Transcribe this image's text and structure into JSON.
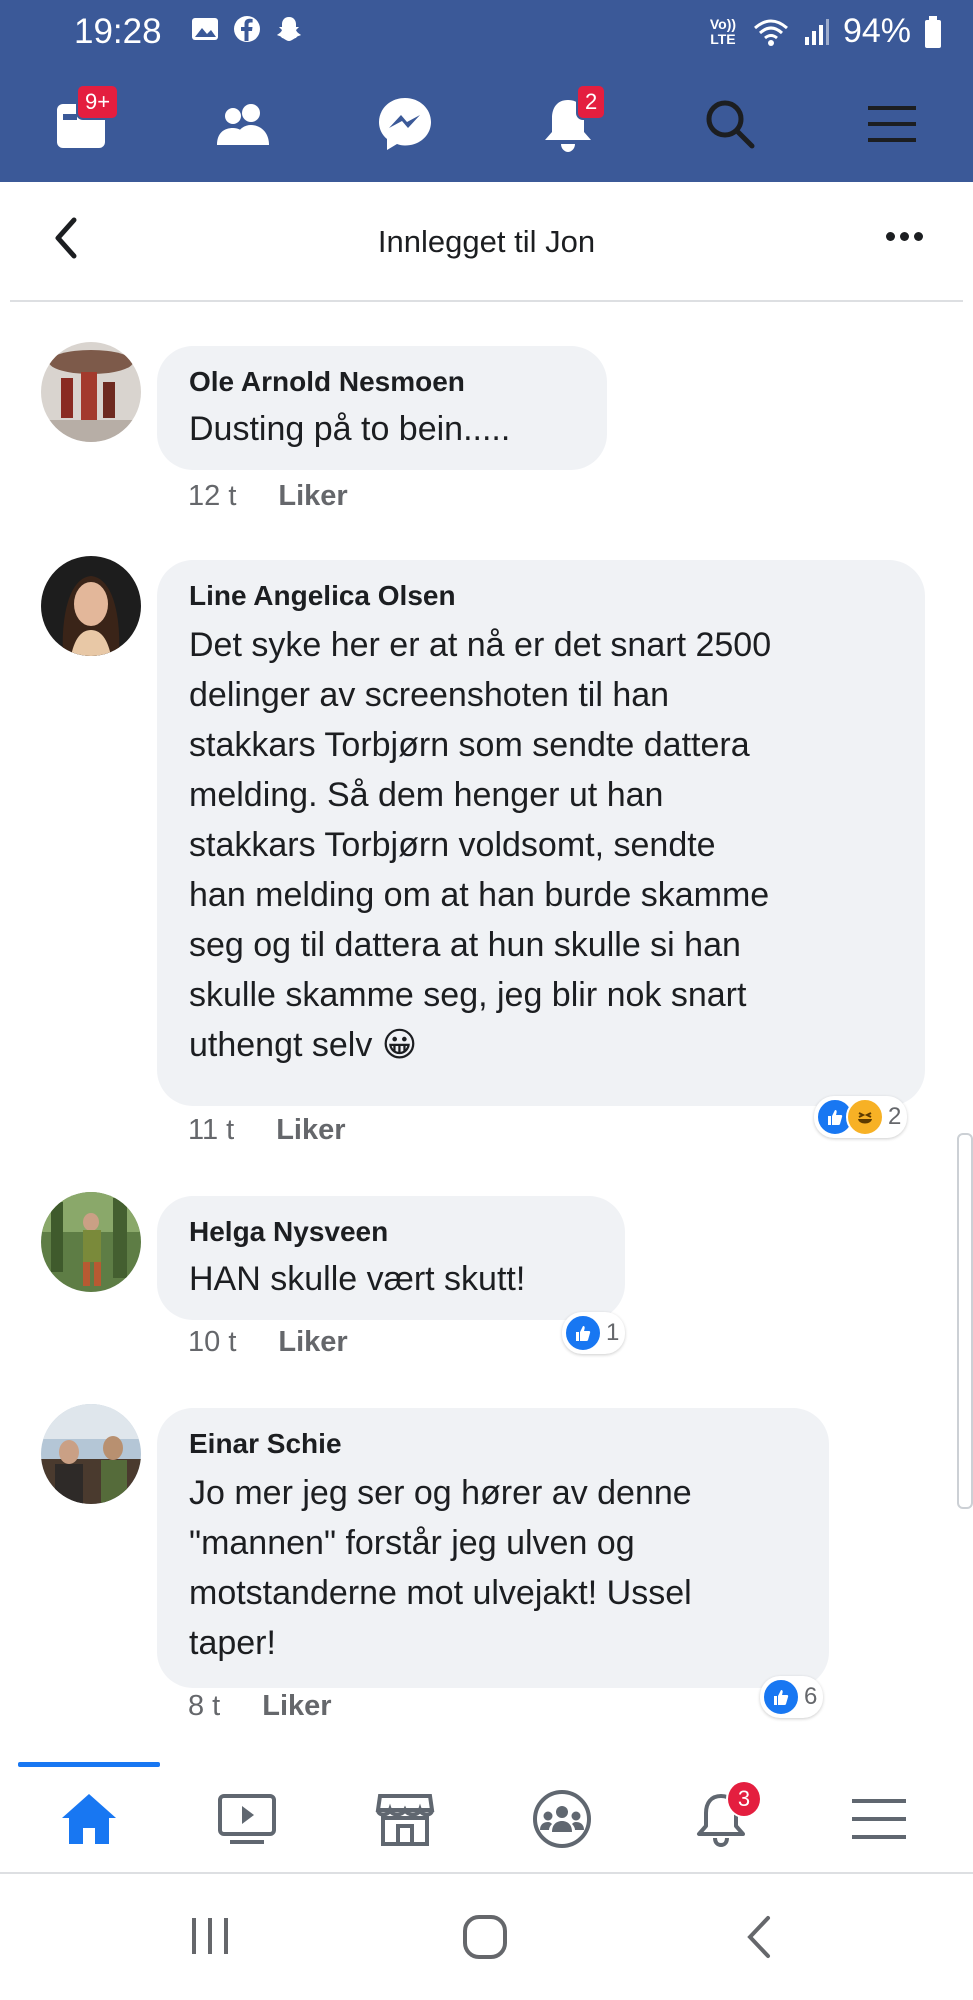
{
  "status_bar": {
    "time": "19:28",
    "network": "Vo)) LTE",
    "battery": "94%"
  },
  "top_nav": {
    "home_badge": "9+",
    "notifications_badge": "2"
  },
  "header": {
    "title": "Innlegget til Jon"
  },
  "comments": [
    {
      "name": "Ole Arnold Nesmoen",
      "text": "Dusting på to bein.....",
      "time": "12 t",
      "like_label": "Liker"
    },
    {
      "name": "Line Angelica Olsen",
      "text": "Det syke her er at nå er det snart 2500\ndelinger av screenshoten til han\nstakkars Torbjørn som sendte dattera\nmelding. Så dem henger ut han\nstakkars Torbjørn voldsomt, sendte\nhan melding om at han burde skamme\nseg og til dattera at hun skulle si han\nskulle skamme seg, jeg blir nok snart\nuthengt selv 😀",
      "time": "11 t",
      "like_label": "Liker",
      "reaction_count": "2"
    },
    {
      "name": "Helga Nysveen",
      "text": "HAN skulle vært skutt!",
      "time": "10 t",
      "like_label": "Liker",
      "reaction_count": "1"
    },
    {
      "name": "Einar Schie",
      "text": "Jo mer jeg ser og hører av denne\n\"mannen\" forstår jeg ulven og\nmotstanderne mot ulvejakt! Ussel\ntaper!",
      "time": "8 t",
      "like_label": "Liker",
      "reaction_count": "6"
    }
  ],
  "bottom_nav": {
    "notifications_badge": "3"
  },
  "colors": {
    "brand": "#3b5998",
    "accent": "#1877f2",
    "badge": "#e41e3f",
    "bubble": "#f0f2f5"
  },
  "icons": [
    "home-icon",
    "friends-icon",
    "messenger-icon",
    "bell-icon",
    "search-icon",
    "menu-icon",
    "watch-icon",
    "marketplace-icon",
    "groups-icon"
  ]
}
